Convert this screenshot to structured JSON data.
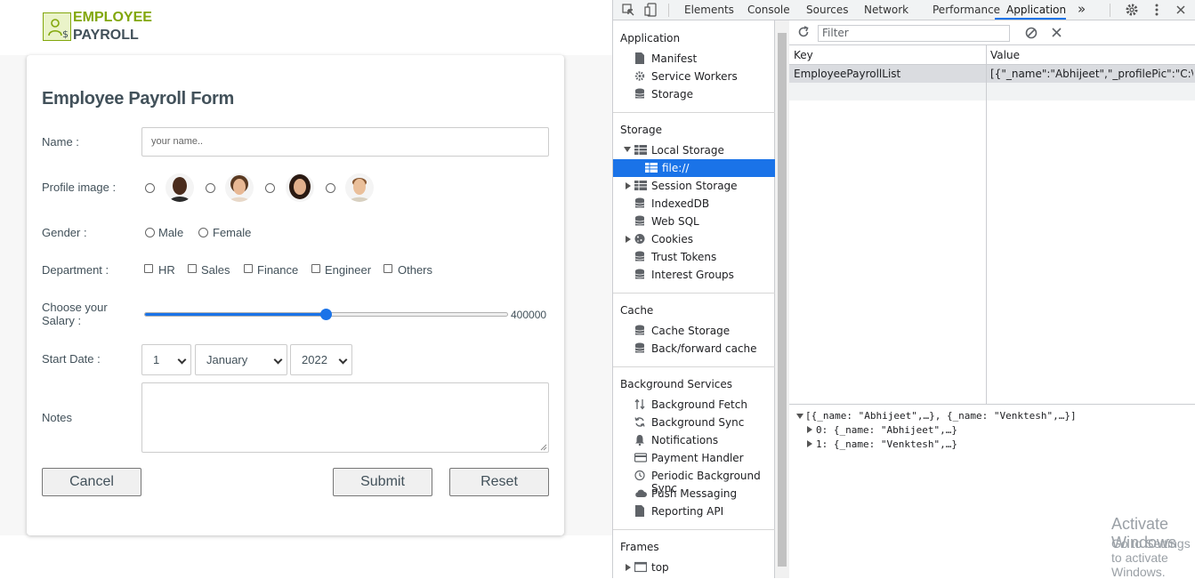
{
  "app": {
    "logo": {
      "line1": "EMPLOYEE",
      "line2": "PAYROLL"
    },
    "form": {
      "title": "Employee Payroll Form",
      "name_label": "Name :",
      "name_placeholder": "your name..",
      "profile_label": "Profile image :",
      "gender_label": "Gender :",
      "gender_options": [
        "Male",
        "Female"
      ],
      "department_label": "Department :",
      "department_options": [
        "HR",
        "Sales",
        "Finance",
        "Engineer",
        "Others"
      ],
      "salary_label_line1": "Choose your",
      "salary_label_line2": "Salary :",
      "salary_value": "400000",
      "salary_fraction": 0.5,
      "start_date_label": "Start Date :",
      "day": "1",
      "month": "January",
      "year": "2022",
      "notes_label": "Notes",
      "cancel_label": "Cancel",
      "submit_label": "Submit",
      "reset_label": "Reset"
    }
  },
  "devtools": {
    "tabs": [
      "Elements",
      "Console",
      "Sources",
      "Network",
      "Performance",
      "Application"
    ],
    "active_tab": "Application",
    "more_tabs": "»",
    "sidebar": {
      "application_header": "Application",
      "application_items": [
        "Manifest",
        "Service Workers",
        "Storage"
      ],
      "storage_header": "Storage",
      "local_storage": "Local Storage",
      "local_storage_child": "file://",
      "session_storage": "Session Storage",
      "storage_items": [
        "IndexedDB",
        "Web SQL"
      ],
      "cookies": "Cookies",
      "storage_items2": [
        "Trust Tokens",
        "Interest Groups"
      ],
      "cache_header": "Cache",
      "cache_items": [
        "Cache Storage",
        "Back/forward cache"
      ],
      "bg_header": "Background Services",
      "bg_items": [
        "Background Fetch",
        "Background Sync",
        "Notifications",
        "Payment Handler",
        "Periodic Background Sync",
        "Push Messaging",
        "Reporting API"
      ],
      "frames_header": "Frames",
      "frames_top": "top"
    },
    "filter_placeholder": "Filter",
    "grid": {
      "key_header": "Key",
      "value_header": "Value",
      "row_key": "EmployeePayrollList",
      "row_value": "[{\"_name\":\"Abhijeet\",\"_profilePic\":\"C:\\\\..."
    },
    "preview": {
      "root": "[{_name: \"Abhijeet\",…}, {_name: \"Venktesh\",…}]",
      "item0": "0: {_name: \"Abhijeet\",…}",
      "item1": "1: {_name: \"Venktesh\",…}"
    }
  },
  "watermark": {
    "line1": "Activate Windows",
    "line2": "Go to Settings to activate Windows."
  }
}
